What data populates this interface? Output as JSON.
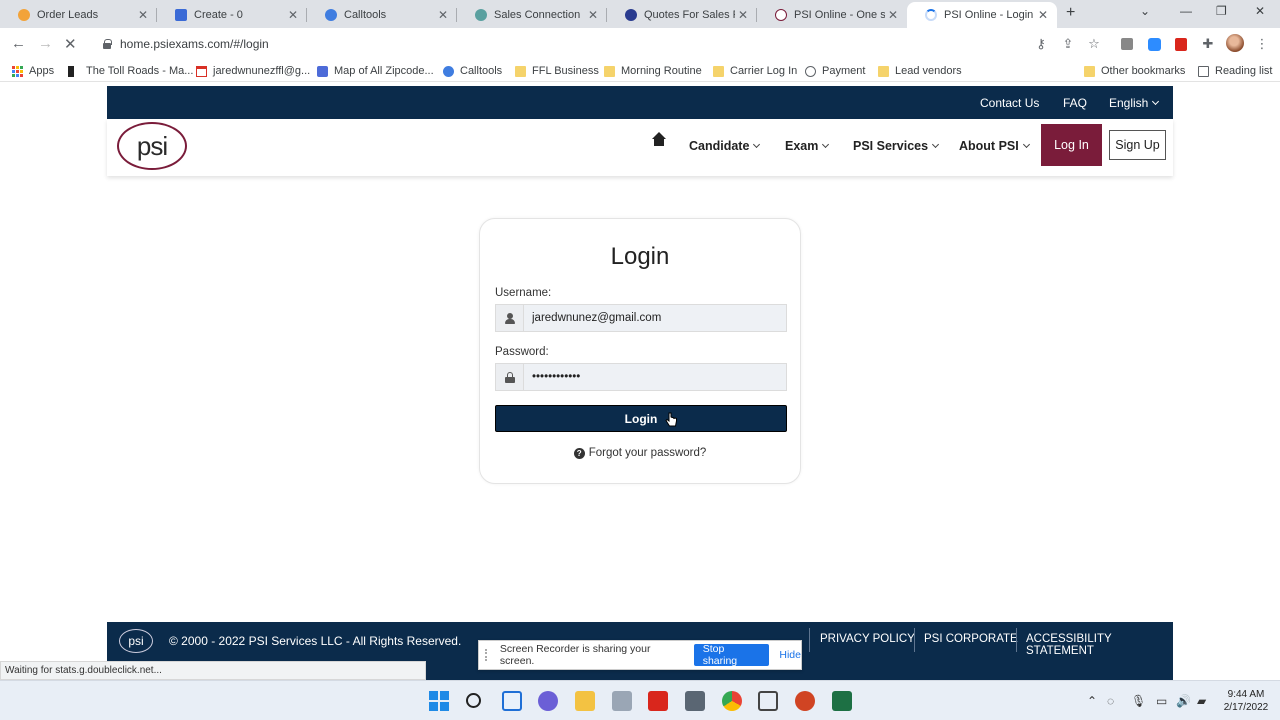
{
  "browser": {
    "tabs": [
      {
        "label": "Order Leads",
        "color": "#f2a33a"
      },
      {
        "label": "Create - 0",
        "color": "#3a6ad6"
      },
      {
        "label": "Calltools",
        "color": "#3f7de0"
      },
      {
        "label": "Sales Connection",
        "color": "#5aa0a0"
      },
      {
        "label": "Quotes For Sales Prof",
        "color": "#2a3b8f"
      },
      {
        "label": "PSI Online - One stop",
        "color": "#7a1c3a"
      },
      {
        "label": "PSI Online - Login",
        "color": "#1a73e8"
      }
    ],
    "new_tab": "+",
    "minimize": "—",
    "maximize": "❐",
    "close": "✕",
    "back": "←",
    "forward": "→",
    "reload": "✕",
    "url": "home.psiexams.com/#/login",
    "key_icon": "⚷",
    "share_icon": "⇪",
    "star_icon": "☆",
    "puzzle_icon": "✚",
    "menu_icon": "⋮",
    "bookmarks": [
      {
        "label": "Apps",
        "type": "apps"
      },
      {
        "label": "The Toll Roads - Ma...",
        "type": "toll"
      },
      {
        "label": "jaredwnunezffl@g...",
        "type": "gmail"
      },
      {
        "label": "Map of All Zipcode...",
        "type": "map"
      },
      {
        "label": "Calltools",
        "type": "calltools"
      },
      {
        "label": "FFL Business",
        "type": "folder"
      },
      {
        "label": "Morning Routine",
        "type": "folder"
      },
      {
        "label": "Carrier Log In",
        "type": "folder"
      },
      {
        "label": "Payment",
        "type": "globe"
      },
      {
        "label": "Lead vendors",
        "type": "folder"
      }
    ],
    "other_bookmarks": "Other bookmarks",
    "reading_list": "Reading list",
    "status_text": "Waiting for stats.g.doubleclick.net..."
  },
  "site": {
    "top_links": [
      "Contact Us",
      "FAQ",
      "English"
    ],
    "logo_text": "psi",
    "nav": {
      "candidate": "Candidate",
      "exam": "Exam",
      "psi_services": "PSI Services",
      "about": "About PSI",
      "login": "Log In",
      "signup": "Sign Up"
    },
    "login_form": {
      "title": "Login",
      "username_label": "Username:",
      "username_value": "jaredwnunez@gmail.com",
      "password_label": "Password:",
      "password_value": "••••••••••••",
      "submit": "Login",
      "forgot": "Forgot your password?"
    },
    "footer": {
      "logo_text": "psi",
      "copyright": "© 2000 - 2022 PSI Services LLC - All Rights Reserved.",
      "links": [
        "PRIVACY POLICY",
        "PSI CORPORATE",
        "ACCESSIBILITY STATEMENT"
      ]
    }
  },
  "screen_share": {
    "message": "Screen Recorder is sharing your screen.",
    "stop": "Stop sharing",
    "hide": "Hide"
  },
  "taskbar": {
    "time": "9:44 AM",
    "date": "2/17/2022"
  }
}
